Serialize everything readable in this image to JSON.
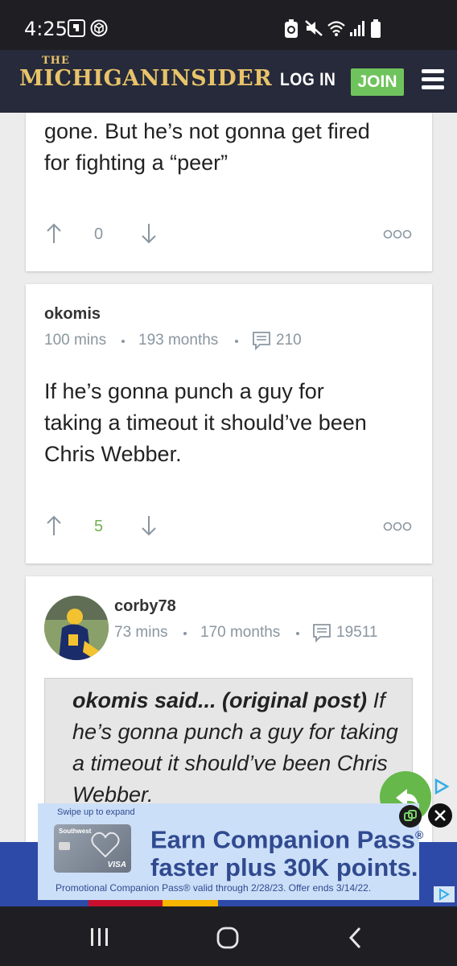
{
  "status_bar": {
    "time": "4:25",
    "left_icons": [
      "app-notification-icon",
      "box-notification-icon"
    ],
    "right_icons": [
      "battery-saver-icon",
      "mute-icon",
      "wifi-icon",
      "signal-icon",
      "battery-icon"
    ]
  },
  "header": {
    "logo_the": "THE",
    "logo_name": "MICHIGANINSIDER",
    "login_label": "LOG IN",
    "join_label": "JOIN",
    "colors": {
      "bar": "#262a3a",
      "logo": "#e8c36a",
      "join": "#6fc35c"
    }
  },
  "posts": [
    {
      "body_line1": "gone. But he’s not gonna get fired",
      "body_line2": "for fighting a “peer”",
      "vote_count": "0"
    },
    {
      "username": "okomis",
      "time_ago": "100 mins",
      "member_age": "193 months",
      "post_count": "210",
      "body_line1": "If he’s gonna punch a guy for",
      "body_line2": "taking a timeout it should’ve been",
      "body_line3": "Chris Webber.",
      "vote_count": "5"
    },
    {
      "username": "corby78",
      "time_ago": "73 mins",
      "member_age": "170 months",
      "post_count": "19511",
      "quote": {
        "author": "okomis said... (original post)",
        "text": "If he’s gonna punch a guy for taking a timeout it should’ve been Chris Webber."
      }
    }
  ],
  "ad": {
    "swipe_hint": "Swipe up to expand",
    "headline_line1": "Earn Companion Pass",
    "headline_reg": "®",
    "headline_line2": "faster plus 30K points.",
    "footer": "Promotional Companion Pass® valid through 2/28/23. Offer ends 3/14/22.",
    "card_brand": "Southwest",
    "card_network": "VISA"
  }
}
